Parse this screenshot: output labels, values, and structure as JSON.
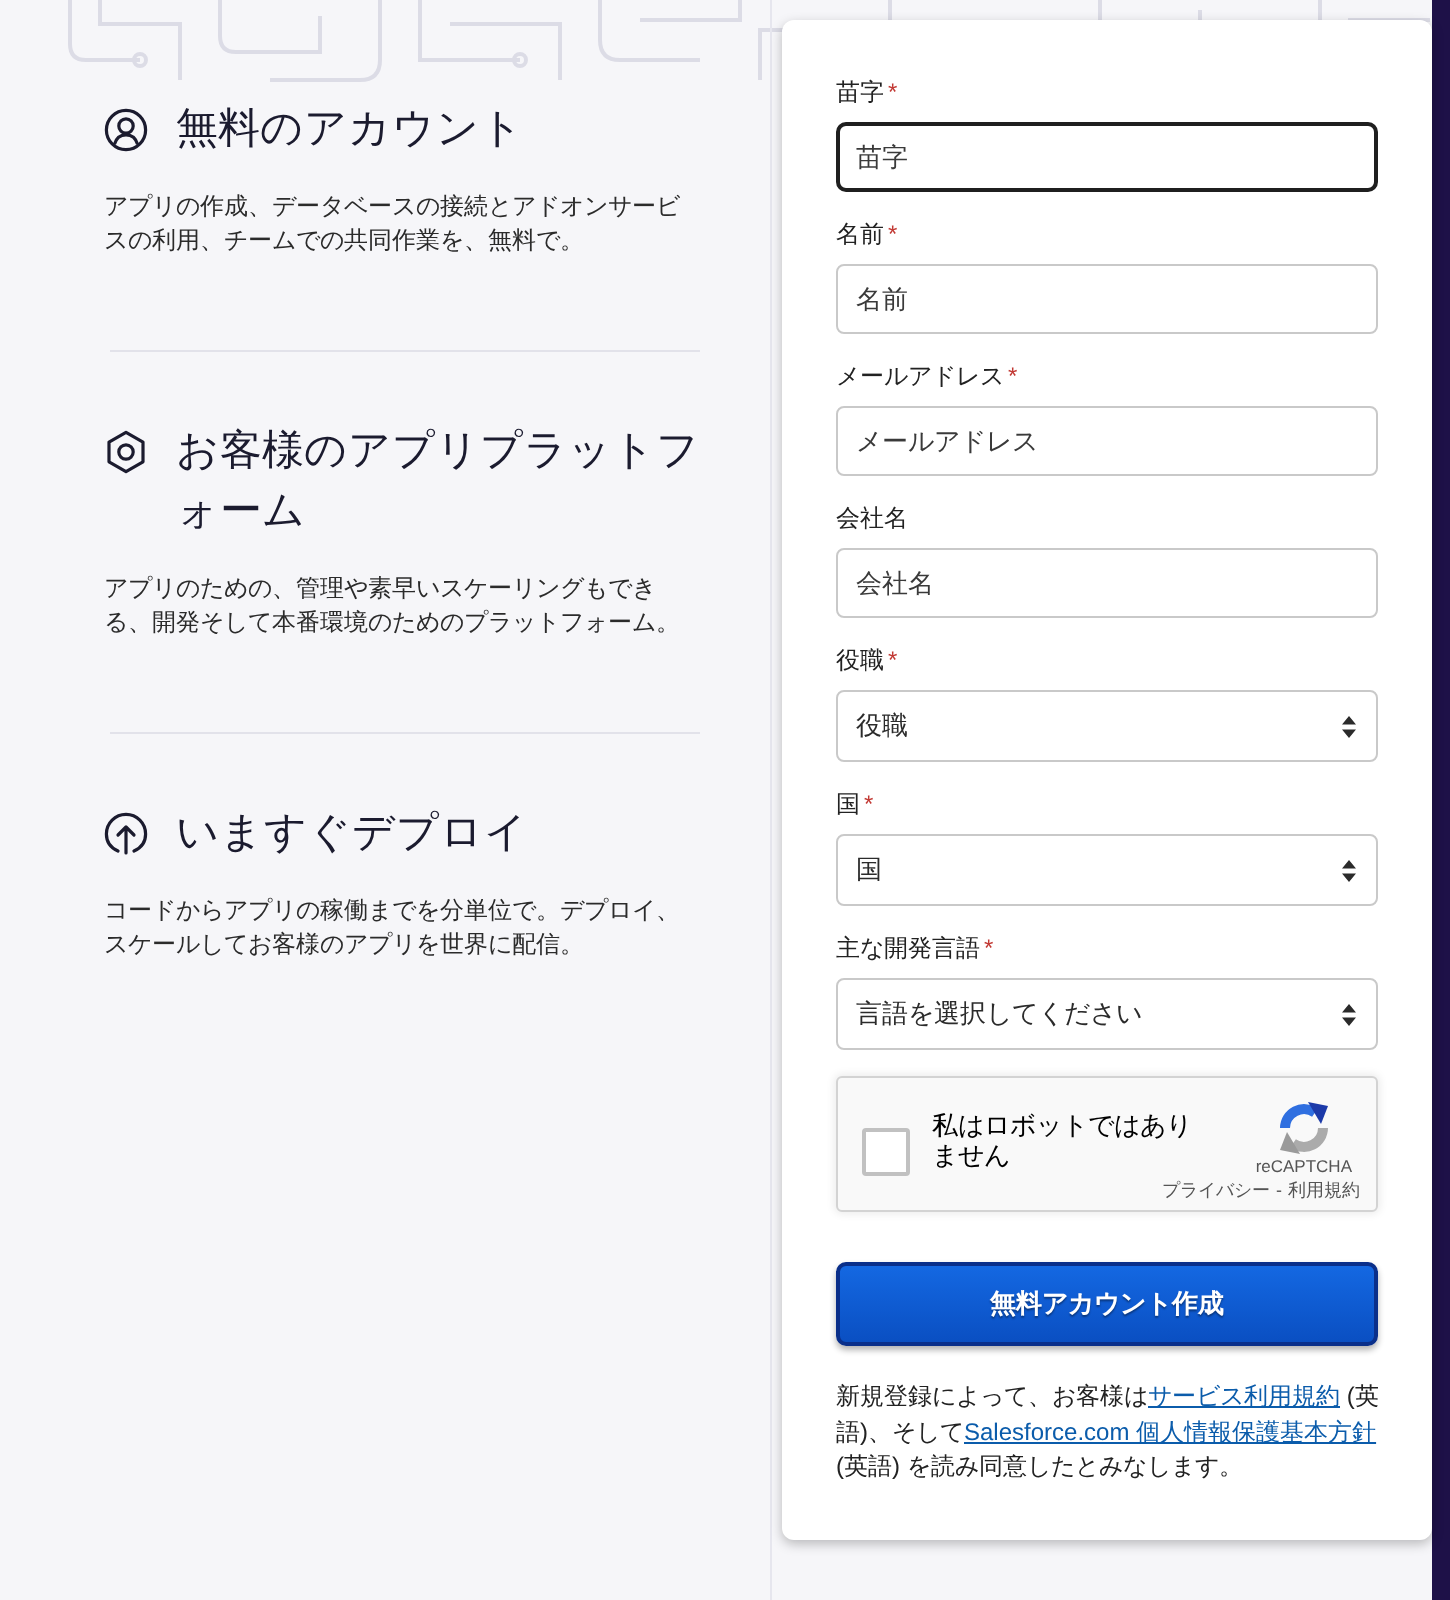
{
  "features": [
    {
      "title": "無料のアカウント",
      "description": "アプリの作成、データベースの接続とアドオンサービスの利用、チームでの共同作業を、無料で。"
    },
    {
      "title": "お客様のアプリプラットフォーム",
      "description": "アプリのための、管理や素早いスケーリングもできる、開発そして本番環境のためのプラットフォーム。"
    },
    {
      "title": "いますぐデプロイ",
      "description": "コードからアプリの稼働までを分単位で。デプロイ、スケールしてお客様のアプリを世界に配信。"
    }
  ],
  "form": {
    "required_mark": "*",
    "fields": [
      {
        "kind": "text",
        "label": "苗字",
        "required": true,
        "placeholder": "苗字",
        "focused": true
      },
      {
        "kind": "text",
        "label": "名前",
        "required": true,
        "placeholder": "名前",
        "focused": false
      },
      {
        "kind": "text",
        "label": "メールアドレス",
        "required": true,
        "placeholder": "メールアドレス",
        "focused": false
      },
      {
        "kind": "text",
        "label": "会社名",
        "required": false,
        "placeholder": "会社名",
        "focused": false
      },
      {
        "kind": "select",
        "label": "役職",
        "required": true,
        "value": "役職"
      },
      {
        "kind": "select",
        "label": "国",
        "required": true,
        "value": "国"
      },
      {
        "kind": "select",
        "label": "主な開発言語",
        "required": true,
        "value": "言語を選択してください"
      }
    ],
    "captcha": {
      "label": "私はロボットではありません",
      "checked": false,
      "brand": "reCAPTCHA",
      "links": [
        "プライバシー",
        "利用規約"
      ],
      "separator": "-"
    },
    "submit_button": "無料アカウント作成",
    "terms_notice": [
      {
        "kind": "text",
        "text": "新規登録によって、お客様は"
      },
      {
        "kind": "link",
        "text": "サービス利用規約"
      },
      {
        "kind": "text",
        "text": " (英語)、そして"
      },
      {
        "kind": "link",
        "text": "Salesforce.com 個人情報保護基本方針"
      },
      {
        "kind": "text",
        "text": " (英語) を読み同意したとみなします。"
      }
    ]
  }
}
